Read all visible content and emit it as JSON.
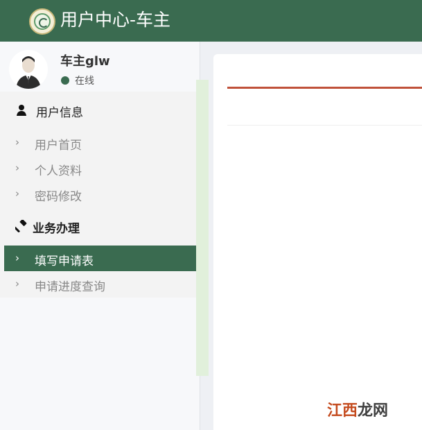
{
  "app": {
    "title": "用户中心-车主"
  },
  "user": {
    "name": "车主glw",
    "status": "在线"
  },
  "menu": {
    "sections": [
      {
        "label": "用户信息",
        "icon": "user-icon"
      },
      {
        "label": "业务办理",
        "icon": "gavel-icon"
      }
    ],
    "user_items": [
      "用户首页",
      "个人资料",
      "密码修改"
    ],
    "business_items": [
      "填写申请表",
      "申请进度查询"
    ],
    "active_item": "填写申请表"
  },
  "watermark": {
    "part1": "江西",
    "part2": "龙网"
  },
  "colors": {
    "header": "#3a6b50",
    "active": "#3a6b50",
    "tab_accent": "#c0513a",
    "status": "#3a6b50"
  }
}
